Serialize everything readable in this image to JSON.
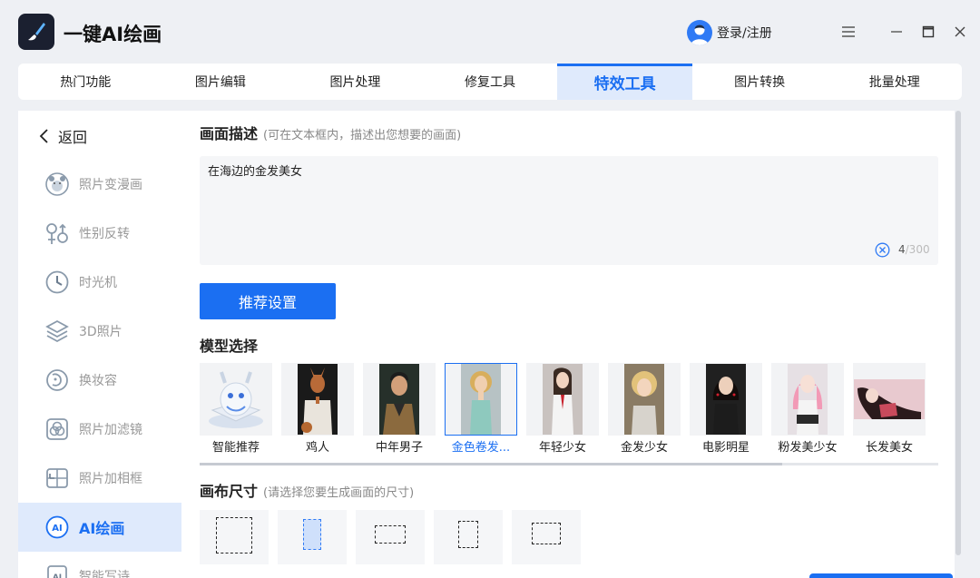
{
  "app": {
    "title": "一键AI绘画",
    "login_label": "登录/注册"
  },
  "tabs": [
    {
      "label": "热门功能"
    },
    {
      "label": "图片编辑"
    },
    {
      "label": "图片处理"
    },
    {
      "label": "修复工具"
    },
    {
      "label": "特效工具",
      "active": true
    },
    {
      "label": "图片转换"
    },
    {
      "label": "批量处理"
    }
  ],
  "sidebar": {
    "back_label": "返回",
    "items": [
      {
        "label": "照片变漫画",
        "icon": "bear-face-icon"
      },
      {
        "label": "性别反转",
        "icon": "gender-icon"
      },
      {
        "label": "时光机",
        "icon": "clock-icon"
      },
      {
        "label": "3D照片",
        "icon": "layers-icon"
      },
      {
        "label": "换妆容",
        "icon": "makeup-icon"
      },
      {
        "label": "照片加滤镜",
        "icon": "filter-icon"
      },
      {
        "label": "照片加相框",
        "icon": "frame-icon"
      },
      {
        "label": "AI绘画",
        "icon": "ai-paint-icon",
        "active": true
      },
      {
        "label": "智能写诗",
        "icon": "ai-poem-icon"
      }
    ]
  },
  "description": {
    "title": "画面描述",
    "hint": "(可在文本框内，描述出您想要的画面)",
    "value": "在海边的金发美女",
    "count": "4",
    "max": "/300"
  },
  "recommend_button": "推荐设置",
  "models": {
    "title": "模型选择",
    "items": [
      {
        "label": "智能推荐"
      },
      {
        "label": "鸡人"
      },
      {
        "label": "中年男子"
      },
      {
        "label": "金色卷发...",
        "selected": true
      },
      {
        "label": "年轻少女"
      },
      {
        "label": "金发少女"
      },
      {
        "label": "电影明星"
      },
      {
        "label": "粉发美少女"
      },
      {
        "label": "长发美女"
      }
    ]
  },
  "canvas_size": {
    "title": "画布尺寸",
    "hint": "(请选择您要生成画面的尺寸)",
    "options": [
      "1:1",
      "9:16",
      "16:9",
      "3:4",
      "4:3"
    ],
    "selected": "9:16"
  },
  "colors": {
    "accent": "#1b6ff2",
    "active_bg": "#dfeafc"
  }
}
